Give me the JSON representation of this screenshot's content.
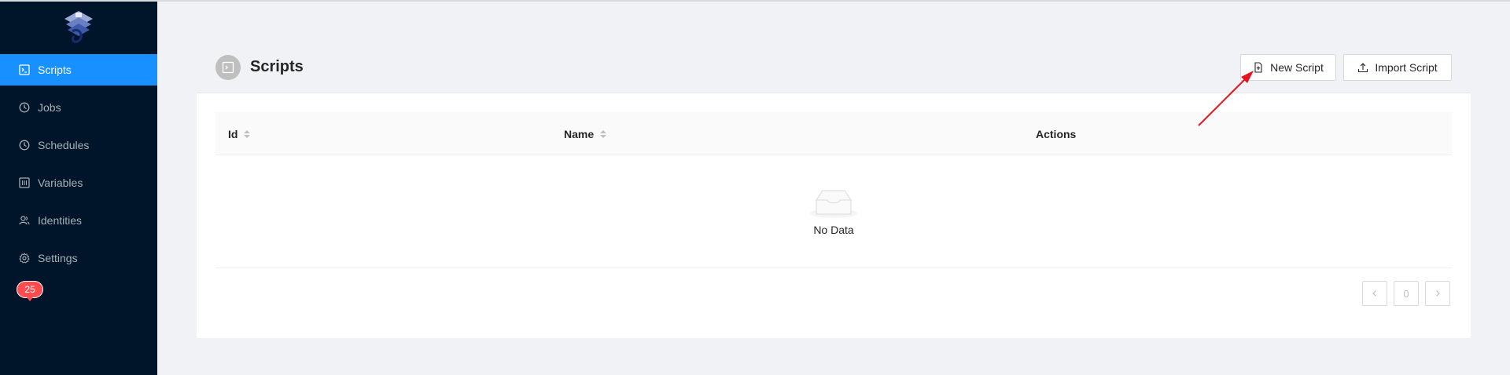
{
  "sidebar": {
    "items": [
      {
        "label": "Scripts",
        "icon": "terminal-icon",
        "active": true
      },
      {
        "label": "Jobs",
        "icon": "clock-icon"
      },
      {
        "label": "Schedules",
        "icon": "clock-icon"
      },
      {
        "label": "Variables",
        "icon": "sliders-icon"
      },
      {
        "label": "Identities",
        "icon": "users-icon"
      },
      {
        "label": "Settings",
        "icon": "gear-icon"
      }
    ],
    "badge": "25"
  },
  "card": {
    "title": "Scripts",
    "new_script_label": "New Script",
    "import_script_label": "Import Script"
  },
  "table": {
    "columns": [
      "Id",
      "Name",
      "Actions"
    ],
    "empty_text": "No Data"
  },
  "pagination": {
    "current_page": "0"
  },
  "colors": {
    "sidebar_bg": "#001529",
    "active_item": "#1890ff",
    "badge": "#ff4d4f",
    "annotation_arrow": "#e8141c"
  }
}
